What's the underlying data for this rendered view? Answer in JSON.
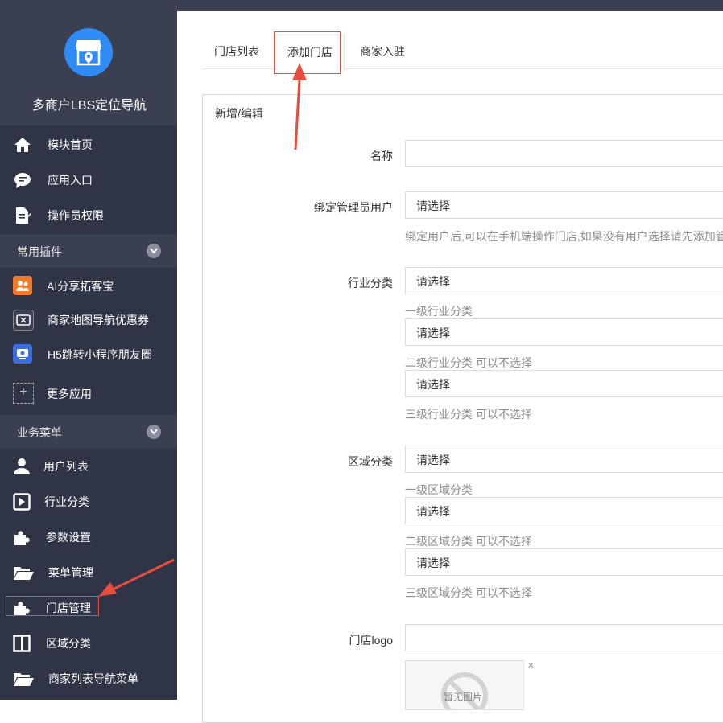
{
  "brand": {
    "title": "多商户LBS定位导航"
  },
  "sidebar": {
    "top_items": [
      {
        "label": "模块首页",
        "icon": "home-icon"
      },
      {
        "label": "应用入口",
        "icon": "chat-icon"
      },
      {
        "label": "操作员权限",
        "icon": "edit-doc-icon"
      }
    ],
    "section_plugins": "常用插件",
    "apps": [
      {
        "label": "AI分享拓客宝",
        "icon": "ai-share-app-icon",
        "color": "#f5792a"
      },
      {
        "label": "商家地图导航优惠券",
        "icon": "coupon-app-icon",
        "color": "#3a3f51"
      },
      {
        "label": "H5跳转小程序朋友圈",
        "icon": "h5-jump-app-icon",
        "color": "#3b6fe0"
      }
    ],
    "more_apps": "更多应用",
    "section_business": "业务菜单",
    "business_items": [
      {
        "label": "用户列表",
        "icon": "user-icon"
      },
      {
        "label": "行业分类",
        "icon": "play-square-icon"
      },
      {
        "label": "参数设置",
        "icon": "puzzle-icon"
      },
      {
        "label": "菜单管理",
        "icon": "folder-open-icon"
      },
      {
        "label": "门店管理",
        "icon": "puzzle-icon"
      },
      {
        "label": "区域分类",
        "icon": "columns-icon"
      },
      {
        "label": "商家列表导航菜单",
        "icon": "folder-open-icon"
      }
    ]
  },
  "tabs": [
    "门店列表",
    "添加门店",
    "商家入驻"
  ],
  "panel": {
    "title": "新增/编辑"
  },
  "form": {
    "name_label": "名称",
    "admin_label": "绑定管理员用户",
    "admin_value": "请选择",
    "admin_help": "绑定用户后,可以在手机端操作门店,如果没有用户选择请先添加管",
    "industry_label": "行业分类",
    "industry": [
      {
        "value": "请选择",
        "help": "一级行业分类"
      },
      {
        "value": "请选择",
        "help": "二级行业分类 可以不选择"
      },
      {
        "value": "请选择",
        "help": "三级行业分类 可以不选择"
      }
    ],
    "region_label": "区域分类",
    "region": [
      {
        "value": "请选择",
        "help": "一级区域分类"
      },
      {
        "value": "请选择",
        "help": "二级区域分类 可以不选择"
      },
      {
        "value": "请选择",
        "help": "三级区域分类 可以不选择"
      }
    ],
    "logo_label": "门店logo",
    "no_image_text": "暂无图片",
    "remove_mark": "×"
  },
  "colors": {
    "sidebar_bg": "#2f3446",
    "section_bg": "#3a3f51",
    "accent_blue": "#2f8cf7",
    "annotation_red": "#e74c3c"
  }
}
